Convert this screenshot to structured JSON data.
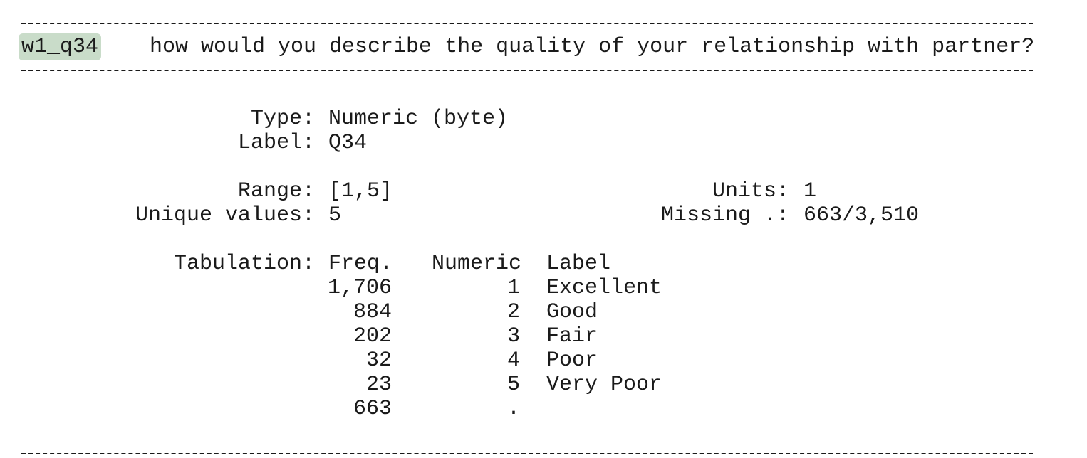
{
  "variable": {
    "name": "w1_q34",
    "question": "how would you describe the quality of your relationship with partner?"
  },
  "fields": {
    "type_label": "Type:",
    "type_value": "Numeric (byte)",
    "label_label": "Label:",
    "label_value": "Q34",
    "range_label": "Range:",
    "range_value": "[1,5]",
    "units_label": "Units:",
    "units_value": "1",
    "unique_label": "Unique values:",
    "unique_value": "5",
    "missing_label": "Missing .:",
    "missing_value": "663/3,510"
  },
  "tabulation": {
    "label": "Tabulation:",
    "headers": {
      "freq": "Freq.",
      "numeric": "Numeric",
      "label": "Label"
    },
    "rows": [
      {
        "freq": "1,706",
        "numeric": "1",
        "label": "Excellent"
      },
      {
        "freq": "884",
        "numeric": "2",
        "label": "Good"
      },
      {
        "freq": "202",
        "numeric": "3",
        "label": "Fair"
      },
      {
        "freq": "32",
        "numeric": "4",
        "label": "Poor"
      },
      {
        "freq": "23",
        "numeric": "5",
        "label": "Very Poor"
      },
      {
        "freq": "663",
        "numeric": ".",
        "label": ""
      }
    ]
  }
}
